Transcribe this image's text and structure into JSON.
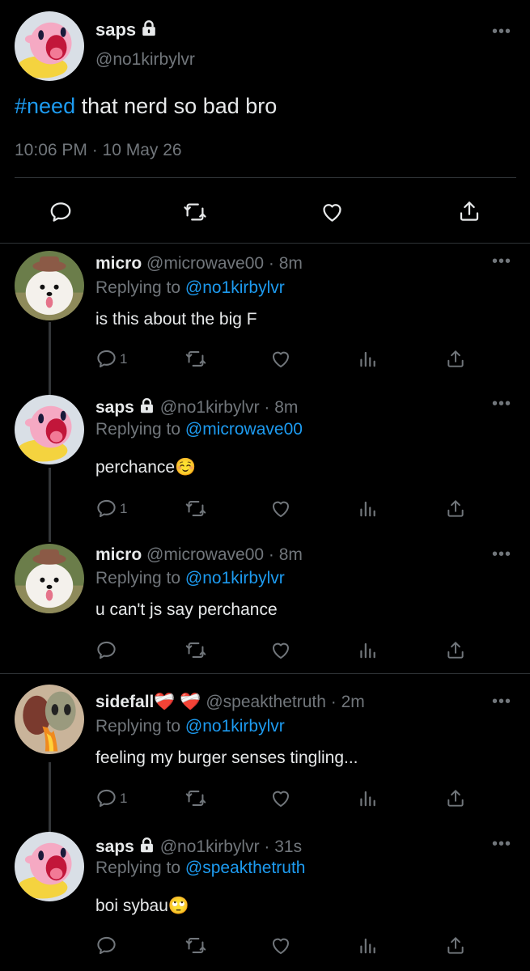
{
  "main": {
    "name": "saps",
    "handle": "@no1kirbylvr",
    "hashtag": "#need",
    "text": " that nerd so bad bro",
    "timestamp": "10:06 PM · 10 May 26",
    "more": "•••"
  },
  "replies": [
    {
      "name": "micro",
      "handle": "@microwave00",
      "time": "· 8m",
      "replying_prefix": "Replying to",
      "replying_to": "@no1kirbylvr",
      "text": "is this about the big F",
      "reply_count": "1",
      "avatar": "dog-avatar"
    },
    {
      "name": "saps",
      "handle": "@no1kirbylvr",
      "time": "· 8m",
      "replying_prefix": "Replying to",
      "replying_to": "@microwave00",
      "text": "perchance☺️",
      "reply_count": "1",
      "avatar": "kirby-avatar"
    },
    {
      "name": "micro",
      "handle": "@microwave00",
      "time": "· 8m",
      "replying_prefix": "Replying to",
      "replying_to": "@no1kirbylvr",
      "text": "u can't js say perchance",
      "reply_count": "",
      "avatar": "dog-avatar"
    },
    {
      "name": "sidefall❤️‍🩹 ❤️‍🩹",
      "handle": "@speakthetruth",
      "time": "· 2m",
      "replying_prefix": "Replying to",
      "replying_to": "@no1kirbylvr",
      "text": "feeling my burger senses tingling...",
      "reply_count": "1",
      "avatar": "alien-avatar"
    },
    {
      "name": "saps",
      "handle": "@no1kirbylvr",
      "time": "· 31s",
      "replying_prefix": "Replying to",
      "replying_to": "@speakthetruth",
      "text": "boi sybau🙄",
      "reply_count": "",
      "avatar": "kirby-avatar"
    }
  ],
  "colors": {
    "background": "#000000",
    "text": "#e7e9ea",
    "muted": "#71767b",
    "link": "#1d9bf0"
  }
}
